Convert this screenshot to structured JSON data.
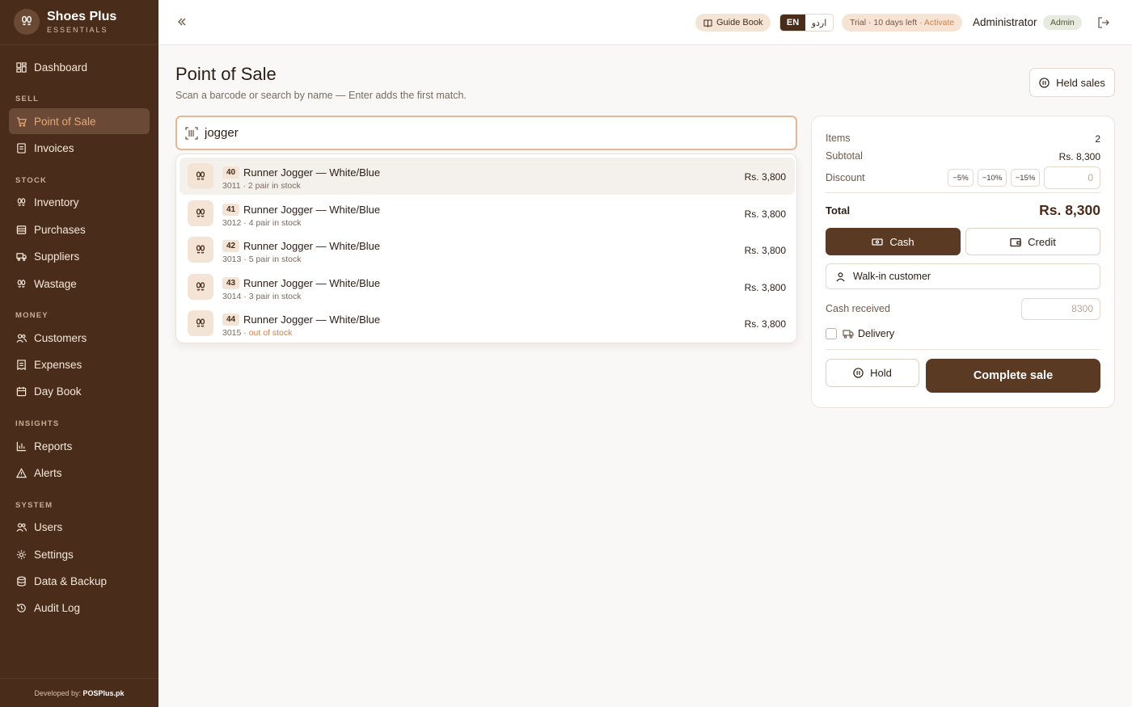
{
  "brand": {
    "name": "Shoes Plus",
    "subtitle": "ESSENTIALS"
  },
  "sidebar": {
    "dashboard": "Dashboard",
    "sections": {
      "sell": "SELL",
      "stock": "STOCK",
      "money": "MONEY",
      "insights": "INSIGHTS",
      "system": "SYSTEM"
    },
    "items": {
      "pos": "Point of Sale",
      "invoices": "Invoices",
      "inventory": "Inventory",
      "purchases": "Purchases",
      "suppliers": "Suppliers",
      "wastage": "Wastage",
      "customers": "Customers",
      "expenses": "Expenses",
      "daybook": "Day Book",
      "reports": "Reports",
      "alerts": "Alerts",
      "users": "Users",
      "settings": "Settings",
      "backup": "Data & Backup",
      "audit": "Audit Log"
    },
    "active": "pos",
    "developed_by": "Developed by:",
    "developer": "POSPlus.pk"
  },
  "topbar": {
    "guide": "Guide Book",
    "lang_en": "EN",
    "lang_ur": "اردو",
    "trial": "Trial · 10 days left",
    "activate": "· Activate",
    "user": "Administrator",
    "role": "Admin"
  },
  "page": {
    "title": "Point of Sale",
    "subtitle": "Scan a barcode or search by name — Enter adds the first match.",
    "held_sales": "Held sales"
  },
  "search": {
    "value": "jogger"
  },
  "results": [
    {
      "size": "40",
      "name": "Runner Jogger — White/Blue",
      "code": "3011 · ",
      "stock": "2 pair in stock",
      "in_stock": true,
      "price": "Rs. 3,800"
    },
    {
      "size": "41",
      "name": "Runner Jogger — White/Blue",
      "code": "3012 · ",
      "stock": "4 pair in stock",
      "in_stock": true,
      "price": "Rs. 3,800"
    },
    {
      "size": "42",
      "name": "Runner Jogger — White/Blue",
      "code": "3013 · ",
      "stock": "5 pair in stock",
      "in_stock": true,
      "price": "Rs. 3,800"
    },
    {
      "size": "43",
      "name": "Runner Jogger — White/Blue",
      "code": "3014 · ",
      "stock": "3 pair in stock",
      "in_stock": true,
      "price": "Rs. 3,800"
    },
    {
      "size": "44",
      "name": "Runner Jogger — White/Blue",
      "code": "3015 · ",
      "stock": "out of stock",
      "in_stock": false,
      "price": "Rs. 3,800"
    }
  ],
  "cart": {
    "items_label": "Items",
    "items_value": "2",
    "subtotal_label": "Subtotal",
    "subtotal_value": "Rs. 8,300",
    "discount_label": "Discount",
    "discount_presets": [
      "−5%",
      "−10%",
      "−15%"
    ],
    "discount_value": "0",
    "total_label": "Total",
    "total_value": "Rs. 8,300",
    "cash": "Cash",
    "credit": "Credit",
    "customer": "Walk-in customer",
    "cash_received_label": "Cash received",
    "cash_received_placeholder": "8300",
    "delivery": "Delivery",
    "hold": "Hold",
    "complete": "Complete sale"
  },
  "colors": {
    "sidebar_bg": "#4a2c1a",
    "accent": "#5b3a24",
    "active_text": "#e6a877",
    "highlight": "#c98353"
  }
}
